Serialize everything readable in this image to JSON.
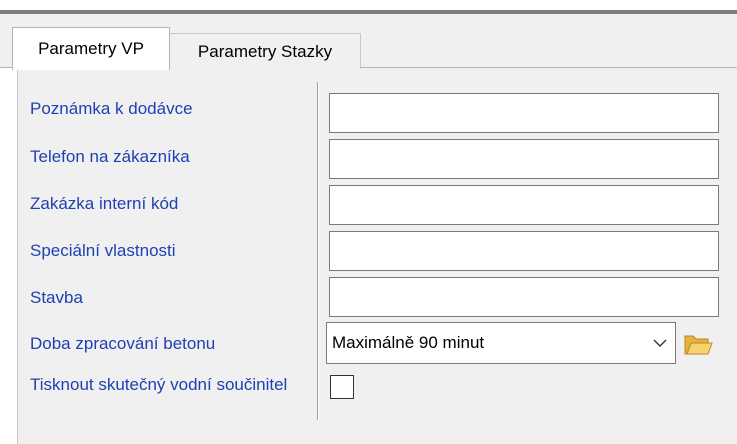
{
  "tabs": [
    {
      "label": "Parametry VP",
      "active": true
    },
    {
      "label": "Parametry Stazky",
      "active": false
    }
  ],
  "form": {
    "fields": [
      {
        "label": "Poznámka k dodávce",
        "value": ""
      },
      {
        "label": "Telefon na zákazníka",
        "value": ""
      },
      {
        "label": "Zakázka interní kód",
        "value": ""
      },
      {
        "label": "Speciální vlastnosti",
        "value": ""
      },
      {
        "label": "Stavba",
        "value": ""
      }
    ],
    "concrete_time": {
      "label": "Doba zpracování betonu",
      "selected": "Maximálně 90 minut"
    },
    "print_water": {
      "label": "Tisknout skutečný vodní součinitel",
      "checked": false
    }
  },
  "colors": {
    "label_blue": "#1f3fb4",
    "panel_bg": "#f0f0f0",
    "folder_yellow": "#f2c14e"
  },
  "icons": {
    "dropdown": "chevron-down-icon",
    "browse": "folder-open-icon"
  }
}
